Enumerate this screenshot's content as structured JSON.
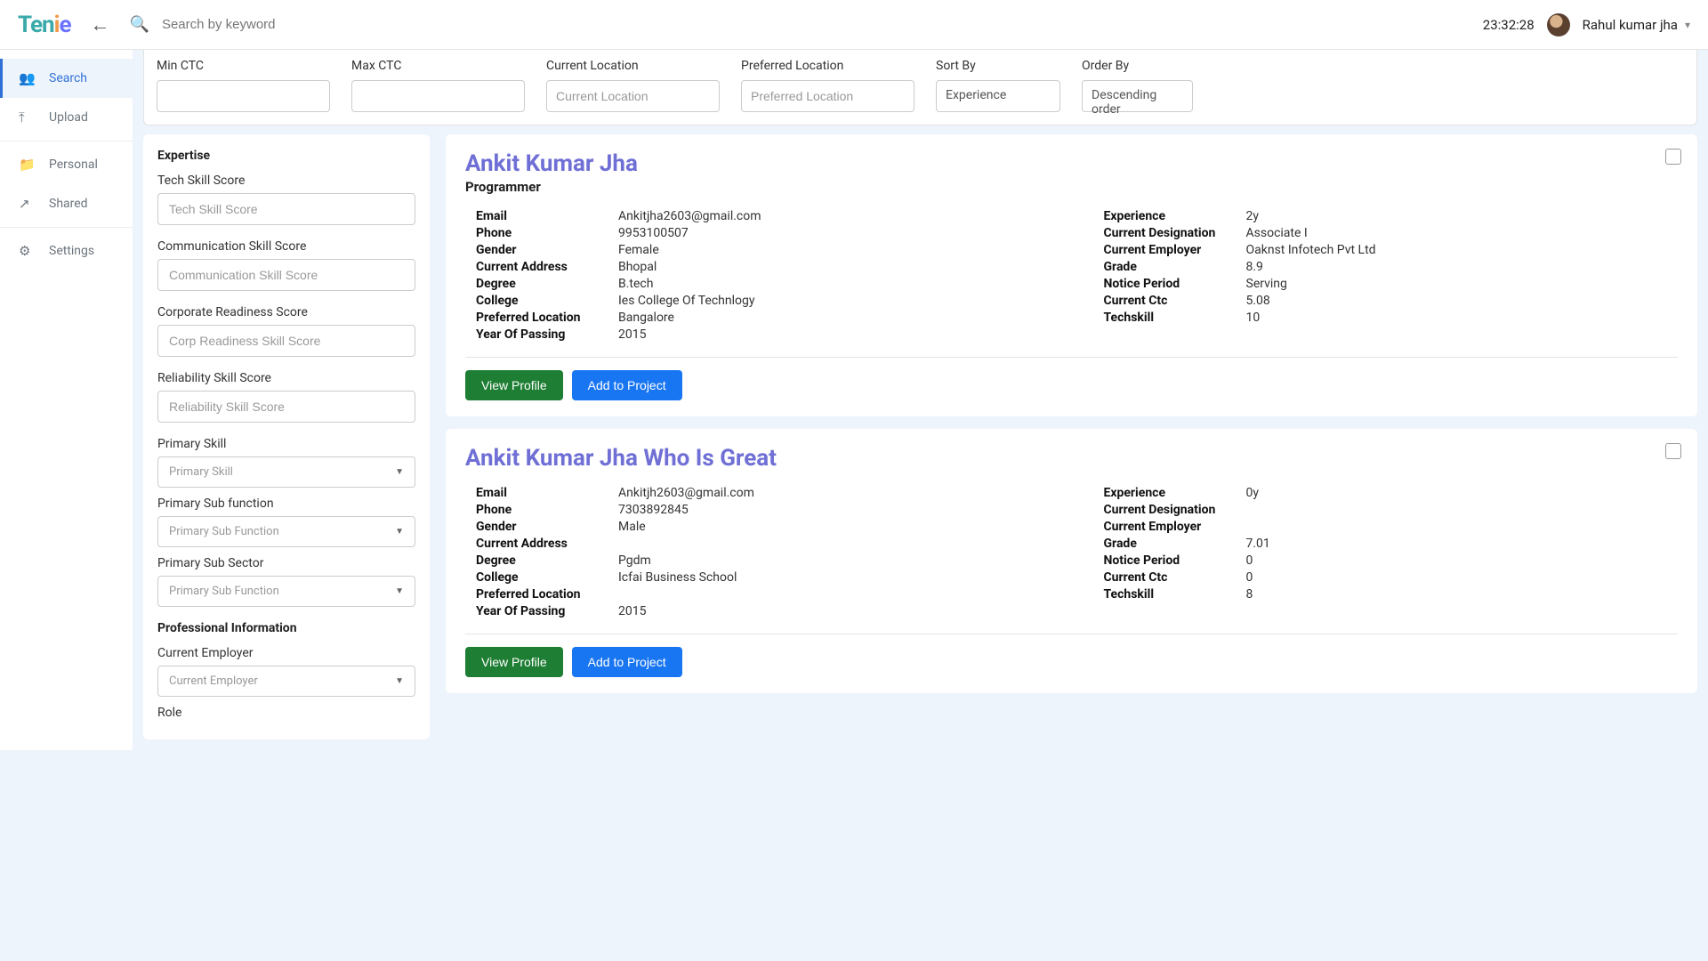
{
  "header": {
    "logo_text": "Tenie",
    "search_placeholder": "Search by keyword",
    "clock": "23:32:28",
    "username": "Rahul kumar jha"
  },
  "sidebar": {
    "items": [
      {
        "label": "Search"
      },
      {
        "label": "Upload"
      },
      {
        "label": "Personal"
      },
      {
        "label": "Shared"
      },
      {
        "label": "Settings"
      }
    ]
  },
  "filters": {
    "min_ctc_label": "Min CTC",
    "max_ctc_label": "Max CTC",
    "current_location_label": "Current Location",
    "preferred_location_label": "Preferred Location",
    "sort_by_label": "Sort By",
    "order_by_label": "Order By",
    "current_location_placeholder": "Current Location",
    "preferred_location_placeholder": "Preferred Location",
    "sort_by_value": "Experience",
    "order_by_value": "Descending order"
  },
  "leftPanel": {
    "expertise_heading": "Expertise",
    "tech_skill_label": "Tech Skill Score",
    "tech_skill_placeholder": "Tech Skill Score",
    "comm_skill_label": "Communication Skill Score",
    "comm_skill_placeholder": "Communication Skill Score",
    "corp_label": "Corporate Readiness Score",
    "corp_placeholder": "Corp Readiness Skill Score",
    "reliability_label": "Reliability Skill Score",
    "reliability_placeholder": "Reliability Skill Score",
    "primary_skill_label": "Primary Skill",
    "primary_skill_placeholder": "Primary Skill",
    "primary_subfunc_label": "Primary Sub function",
    "primary_subfunc_placeholder": "Primary Sub Function",
    "primary_subsector_label": "Primary Sub Sector",
    "primary_subsector_placeholder": "Primary Sub Function",
    "prof_info_heading": "Professional Information",
    "current_employer_label": "Current Employer",
    "current_employer_placeholder": "Current Employer",
    "role_label": "Role"
  },
  "actions": {
    "view_profile": "View Profile",
    "add_to_project": "Add to Project"
  },
  "candidates": [
    {
      "name": "Ankit Kumar Jha",
      "role": "Programmer",
      "left": [
        {
          "label": "Email",
          "value": "Ankitjha2603@gmail.com"
        },
        {
          "label": "Phone",
          "value": "9953100507"
        },
        {
          "label": "Gender",
          "value": "Female"
        },
        {
          "label": "Current Address",
          "value": "Bhopal"
        },
        {
          "label": "Degree",
          "value": "B.tech"
        },
        {
          "label": "College",
          "value": "Ies College Of Technlogy"
        },
        {
          "label": "Preferred Location",
          "value": "Bangalore"
        },
        {
          "label": "Year Of Passing",
          "value": "2015"
        }
      ],
      "right": [
        {
          "label": "Experience",
          "value": "2y"
        },
        {
          "label": "Current Designation",
          "value": "Associate I"
        },
        {
          "label": "Current Employer",
          "value": "Oaknst Infotech Pvt Ltd"
        },
        {
          "label": "Grade",
          "value": "8.9"
        },
        {
          "label": "Notice Period",
          "value": "Serving"
        },
        {
          "label": "Current Ctc",
          "value": "5.08"
        },
        {
          "label": "Techskill",
          "value": "10"
        }
      ]
    },
    {
      "name": "Ankit Kumar Jha Who Is Great",
      "role": "",
      "left": [
        {
          "label": "Email",
          "value": "Ankitjh2603@gmail.com"
        },
        {
          "label": "Phone",
          "value": "7303892845"
        },
        {
          "label": "Gender",
          "value": "Male"
        },
        {
          "label": "Current Address",
          "value": ""
        },
        {
          "label": "Degree",
          "value": "Pgdm"
        },
        {
          "label": "College",
          "value": "Icfai Business School"
        },
        {
          "label": "Preferred Location",
          "value": ""
        },
        {
          "label": "Year Of Passing",
          "value": "2015"
        }
      ],
      "right": [
        {
          "label": "Experience",
          "value": "0y"
        },
        {
          "label": "Current Designation",
          "value": ""
        },
        {
          "label": "Current Employer",
          "value": ""
        },
        {
          "label": "Grade",
          "value": "7.01"
        },
        {
          "label": "Notice Period",
          "value": "0"
        },
        {
          "label": "Current Ctc",
          "value": "0"
        },
        {
          "label": "Techskill",
          "value": "8"
        }
      ]
    }
  ]
}
